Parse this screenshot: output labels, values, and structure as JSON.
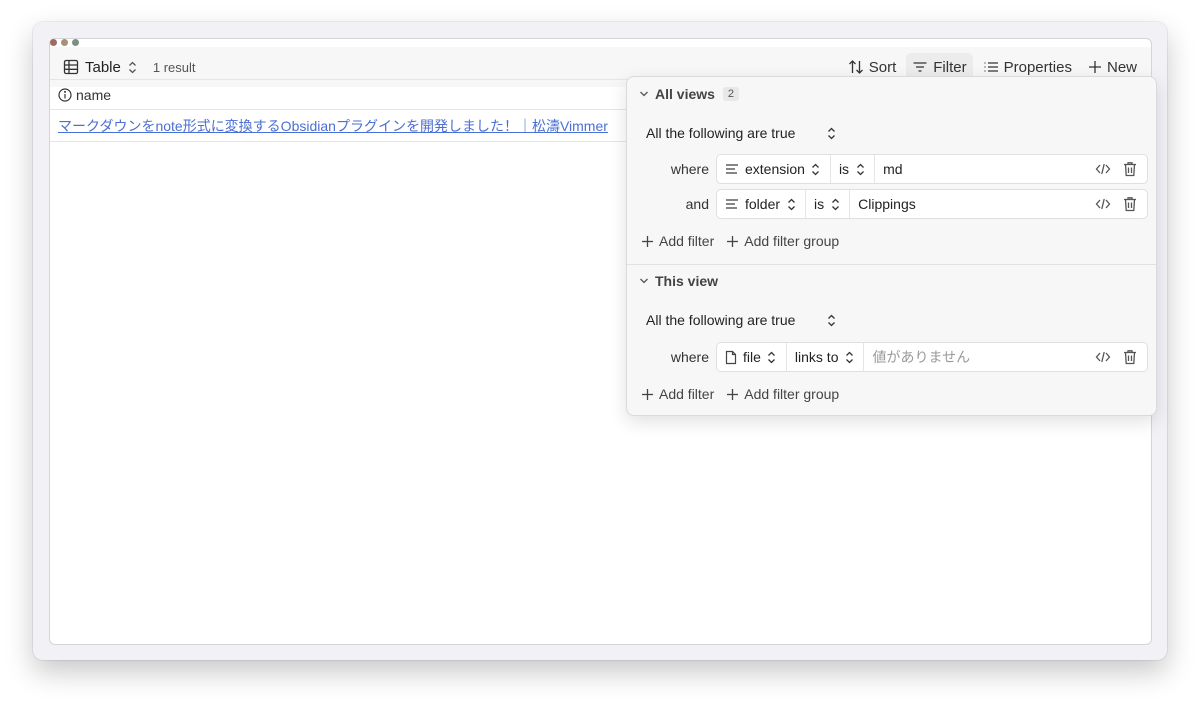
{
  "toolbar": {
    "view_label": "Table",
    "result_count": "1 result",
    "sort_label": "Sort",
    "filter_label": "Filter",
    "properties_label": "Properties",
    "new_label": "New"
  },
  "table": {
    "column_name": "name",
    "rows": [
      {
        "name": "マークダウンをnote形式に変換するObsidianプラグインを開発しました！｜松濤Vimmer"
      }
    ]
  },
  "filter_panel": {
    "all_views": {
      "title": "All views",
      "count": "2",
      "conjunction": "All the following are true",
      "filters": [
        {
          "keyword": "where",
          "property": "extension",
          "operator": "is",
          "value": "md"
        },
        {
          "keyword": "and",
          "property": "folder",
          "operator": "is",
          "value": "Clippings"
        }
      ],
      "add_filter": "Add filter",
      "add_filter_group": "Add filter group"
    },
    "this_view": {
      "title": "This view",
      "conjunction": "All the following are true",
      "filters": [
        {
          "keyword": "where",
          "property": "file",
          "operator": "links to",
          "placeholder": "値がありません"
        }
      ],
      "add_filter": "Add filter",
      "add_filter_group": "Add filter group"
    }
  },
  "colors": {
    "link": "#4b6fd4",
    "traffic_red": "#a36a63",
    "traffic_yellow": "#a49278",
    "traffic_green": "#7c8f84"
  }
}
